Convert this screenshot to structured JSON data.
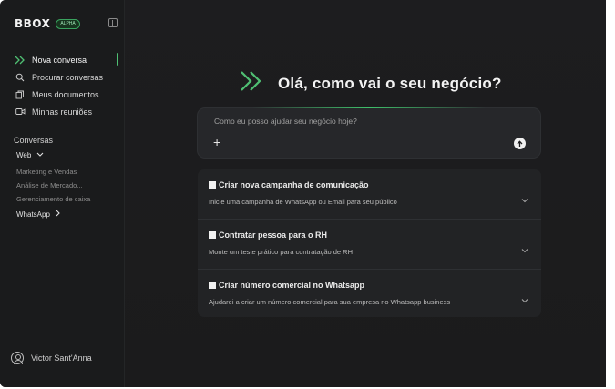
{
  "brand": {
    "logo": "BBOX",
    "badge": "ALPHA"
  },
  "nav": [
    {
      "label": "Nova conversa",
      "icon": "double-chevron-right-icon",
      "active": true
    },
    {
      "label": "Procurar conversas",
      "icon": "search-icon"
    },
    {
      "label": "Meus documentos",
      "icon": "documents-icon"
    },
    {
      "label": "Minhas reuniões",
      "icon": "video-icon"
    }
  ],
  "conversations": {
    "heading": "Conversas",
    "group": "Web",
    "items": [
      "Marketing e Vendas",
      "Análise de Mercado...",
      "Gerenciamento de caixa"
    ],
    "group2": "WhatsApp"
  },
  "user": {
    "name": "Victor Sant'Anna"
  },
  "hero": {
    "title": "Olá, como vai o seu negócio?"
  },
  "chat": {
    "placeholder": "Como eu posso ajudar seu negócio hoje?"
  },
  "suggestions": [
    {
      "title": "Criar nova campanha de comunicação",
      "desc": "Inicie uma campanha de WhatsApp ou Email para seu público"
    },
    {
      "title": "Contratar pessoa para o RH",
      "desc": "Monte um teste prático para contratação de RH"
    },
    {
      "title": "Criar número comercial no Whatsapp",
      "desc": "Ajudarei a criar um número comercial para sua empresa no Whatsapp business"
    }
  ],
  "colors": {
    "accent": "#4fbf73",
    "background": "#1d1d1f",
    "sidebar": "#1a1b1c",
    "card": "#222325"
  }
}
